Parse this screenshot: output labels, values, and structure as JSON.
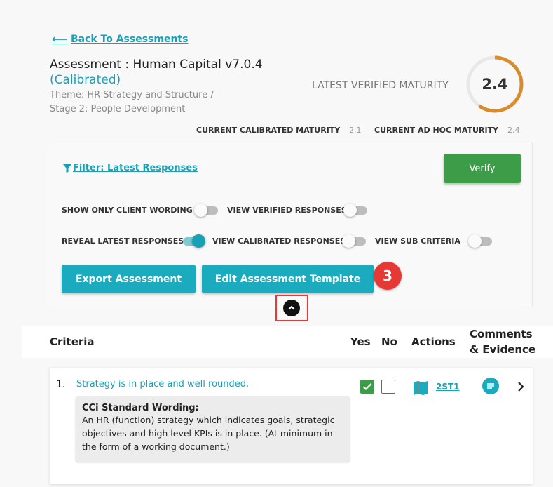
{
  "nav": {
    "back_label": "Back To Assessments"
  },
  "assessment": {
    "title": "Assessment : Human Capital v7.0.4",
    "status": "(Calibrated)",
    "theme": "Theme: HR Strategy and Structure /",
    "stage": "Stage 2: People Development"
  },
  "maturity": {
    "latest_verified_label": "LATEST VERIFIED MATURITY",
    "latest_verified_value": "2.4",
    "latest_verified_fraction": 0.6,
    "current_calibrated_label": "CURRENT CALIBRATED MATURITY",
    "current_calibrated_value": "2.1",
    "current_adhoc_label": "CURRENT AD HOC MATURITY",
    "current_adhoc_value": "2.4"
  },
  "filters": {
    "filter_label": "Filter: Latest Responses",
    "verify_label": "Verify",
    "toggles": {
      "show_only_client_wording": {
        "label": "SHOW ONLY CLIENT WORDING",
        "on": false
      },
      "view_verified_responses": {
        "label": "VIEW VERIFIED RESPONSES",
        "on": false
      },
      "reveal_latest_responses": {
        "label": "REVEAL LATEST RESPONSES",
        "on": true
      },
      "view_calibrated_responses": {
        "label": "VIEW CALIBRATED RESPONSES",
        "on": false
      },
      "view_sub_criteria": {
        "label": "VIEW SUB CRITERIA",
        "on": false
      }
    },
    "export_label": "Export Assessment",
    "edit_template_label": "Edit Assessment Template",
    "step_badge": "3"
  },
  "table": {
    "headers": {
      "criteria": "Criteria",
      "yes": "Yes",
      "no": "No",
      "actions": "Actions",
      "comments_line1": "Comments",
      "comments_line2": "& Evidence"
    },
    "rows": [
      {
        "number": "1.",
        "criterion": "Strategy is in place and well rounded.",
        "standard_title": "CCi Standard Wording:",
        "standard_text": "An HR (function) strategy which indicates goals, strategic objectives and high level KPIs is in place. (At minimum in the form of a working document.)",
        "yes": true,
        "no": false,
        "action_code": "2ST1"
      }
    ]
  },
  "colors": {
    "accent": "#1aa0b4",
    "verify_green": "#3d9c47",
    "gauge_orange": "#d98c2b",
    "badge_red": "#e53935"
  }
}
